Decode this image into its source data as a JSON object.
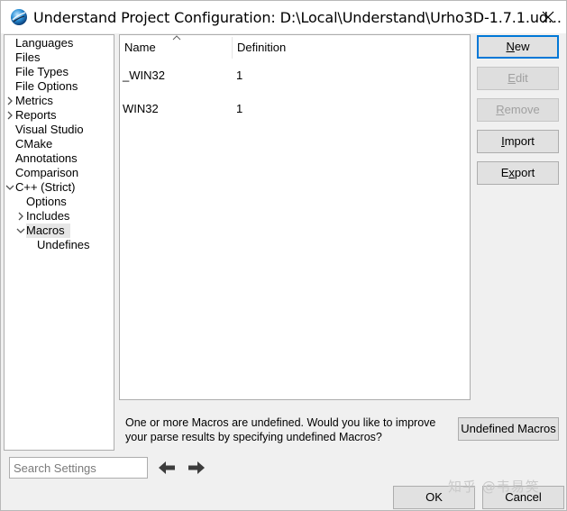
{
  "window": {
    "title": "Understand Project Configuration: D:\\Local\\Understand\\Urho3D-1.7.1.ud..."
  },
  "tree": {
    "items": [
      {
        "label": "Languages",
        "indent": 0,
        "expandable": false
      },
      {
        "label": "Files",
        "indent": 0,
        "expandable": false
      },
      {
        "label": "File Types",
        "indent": 0,
        "expandable": false
      },
      {
        "label": "File Options",
        "indent": 0,
        "expandable": false
      },
      {
        "label": "Metrics",
        "indent": 0,
        "expandable": true,
        "expanded": false
      },
      {
        "label": "Reports",
        "indent": 0,
        "expandable": true,
        "expanded": false
      },
      {
        "label": "Visual Studio",
        "indent": 0,
        "expandable": false
      },
      {
        "label": "CMake",
        "indent": 0,
        "expandable": false
      },
      {
        "label": "Annotations",
        "indent": 0,
        "expandable": false
      },
      {
        "label": "Comparison",
        "indent": 0,
        "expandable": false
      },
      {
        "label": "C++ (Strict)",
        "indent": 0,
        "expandable": true,
        "expanded": true
      },
      {
        "label": "Options",
        "indent": 1,
        "expandable": false
      },
      {
        "label": "Includes",
        "indent": 1,
        "expandable": true,
        "expanded": false
      },
      {
        "label": "Macros",
        "indent": 1,
        "expandable": true,
        "expanded": true,
        "selected": true
      },
      {
        "label": "Undefines",
        "indent": 2,
        "expandable": false
      }
    ]
  },
  "macros_table": {
    "columns": [
      "Name",
      "Definition"
    ],
    "rows": [
      {
        "name": "_WIN32",
        "definition": "1"
      },
      {
        "name": "WIN32",
        "definition": "1"
      }
    ]
  },
  "buttons": {
    "new": {
      "label": "New",
      "mnemonic": "N",
      "rest": "ew"
    },
    "edit": {
      "label": "Edit",
      "mnemonic": "E",
      "rest": "dit"
    },
    "remove": {
      "label": "Remove",
      "mnemonic": "R",
      "rest": "emove"
    },
    "import": {
      "label": "Import",
      "mnemonic": "I",
      "rest": "mport"
    },
    "export": {
      "label": "Export",
      "pre": "E",
      "mnemonic": "x",
      "rest": "port"
    },
    "undefined_macros": "Undefined Macros",
    "ok": "OK",
    "cancel": "Cancel"
  },
  "notice": {
    "line1": "One or more Macros are undefined. Would you like to improve",
    "line2": "your parse results by specifying undefined Macros?"
  },
  "search": {
    "placeholder": "Search Settings"
  },
  "watermark": "知乎 @韦易笑",
  "colors": {
    "default_button_border": "#0078d7",
    "selected_tree_bg": "#e6e6e6",
    "window_bg": "#f0f0f0"
  }
}
